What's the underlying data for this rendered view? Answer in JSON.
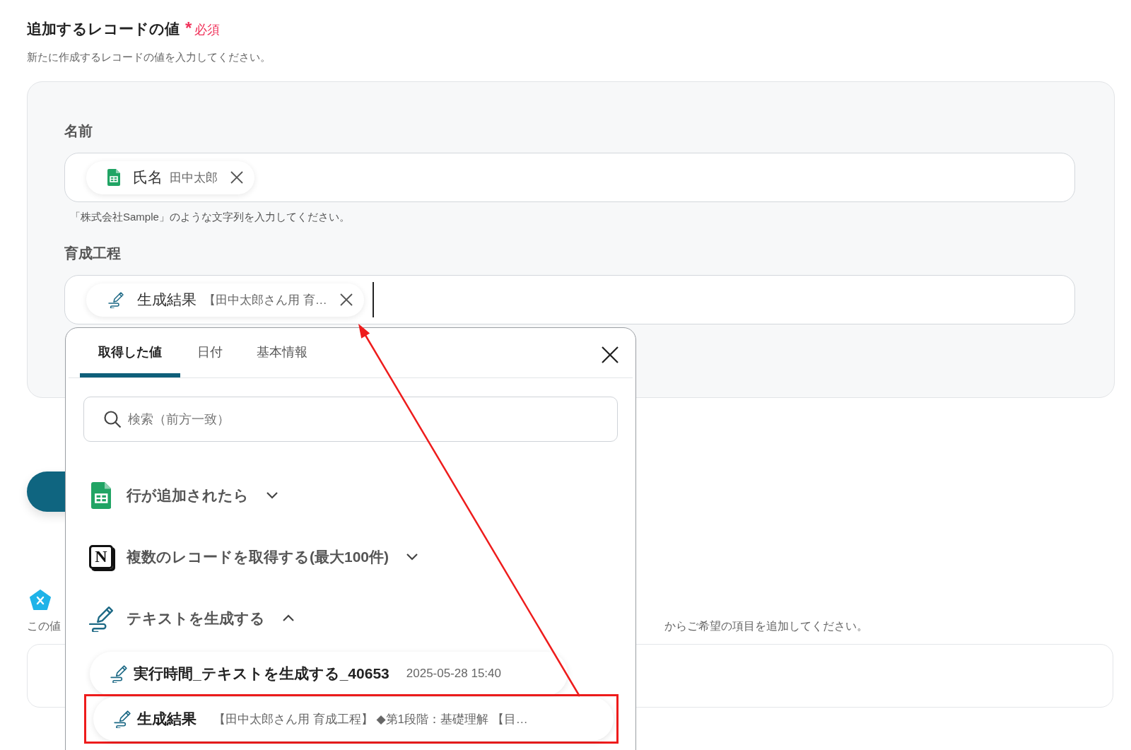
{
  "section": {
    "title": "追加するレコードの値",
    "required_mark": "*",
    "required_label": "必須",
    "description": "新たに作成するレコードの値を入力してください。"
  },
  "fields": [
    {
      "label": "名前",
      "tokens": [
        {
          "kind": "sheet",
          "name": "氏名",
          "value": "田中太郎"
        }
      ],
      "hint": "「株式会社Sample」のような文字列を入力してください。",
      "focused": false
    },
    {
      "label": "育成工程",
      "tokens": [
        {
          "kind": "ai",
          "name": "生成結果",
          "value": "【田中太郎さん用 育…"
        }
      ],
      "focused": true
    }
  ],
  "background": {
    "note_left": "この値",
    "note_right": "からご希望の項目を追加してください。"
  },
  "popup": {
    "tabs": [
      {
        "label": "取得した値",
        "selected": true
      },
      {
        "label": "日付",
        "selected": false
      },
      {
        "label": "基本情報",
        "selected": false
      }
    ],
    "search": {
      "placeholder": "検索（前方一致）"
    },
    "groups": [
      {
        "kind": "sheet",
        "title": "行が追加されたら",
        "expanded": false
      },
      {
        "kind": "notion",
        "badge": "N",
        "title": "複数のレコードを取得する(最大100件)",
        "expanded": false
      },
      {
        "kind": "ai",
        "title": "テキストを生成する",
        "expanded": true,
        "items": [
          {
            "name": "実行時間_テキストを生成する_40653",
            "value": "2025-05-28 15:40",
            "highlighted": false
          },
          {
            "name": "生成結果",
            "value": "【田中太郎さん用 育成工程】 ◆第1段階：基礎理解 【目…",
            "highlighted": true
          }
        ]
      }
    ]
  }
}
